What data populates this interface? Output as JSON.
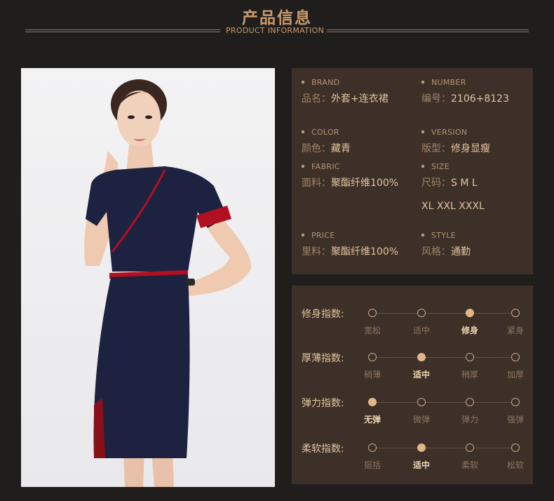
{
  "header": {
    "title": "产品信息",
    "subtitle": "PRODUCT INFORMATION"
  },
  "info": {
    "brand": {
      "key": "BRAND",
      "label": "品名：",
      "value": "外套+连衣裙"
    },
    "number": {
      "key": "NUMBER",
      "label": "编号：",
      "value": "2106+8123"
    },
    "color": {
      "key": "COLOR",
      "label": "颜色：",
      "value": "藏青"
    },
    "version": {
      "key": "VERSION",
      "label": "版型：",
      "value": "修身显瘦"
    },
    "fabric": {
      "key": "FABRIC",
      "label": "面料：",
      "value": "聚酯纤维100%"
    },
    "size": {
      "key": "SIZE",
      "label": "尺码：",
      "value": "S M L",
      "value2": "XL XXL XXXL"
    },
    "price": {
      "key": "PRICE",
      "label": "里料：",
      "value": "聚酯纤维100%"
    },
    "style": {
      "key": "STYLE",
      "label": "风格：",
      "value": "通勤"
    }
  },
  "indices": [
    {
      "name": "修身指数:",
      "options": [
        "宽松",
        "适中",
        "修身",
        "紧身"
      ],
      "selected": 2
    },
    {
      "name": "厚薄指数:",
      "options": [
        "稍薄",
        "适中",
        "稍厚",
        "加厚"
      ],
      "selected": 1
    },
    {
      "name": "弹力指数:",
      "options": [
        "无弹",
        "微弹",
        "弹力",
        "强弹"
      ],
      "selected": 0
    },
    {
      "name": "柔软指数:",
      "options": [
        "挺括",
        "适中",
        "柔软",
        "松软"
      ],
      "selected": 1
    }
  ],
  "colors": {
    "accent": "#c99a6b",
    "panel": "#3d3028",
    "background": "#1f1e1d",
    "dress": "#1c2240",
    "trim": "#b01020"
  }
}
